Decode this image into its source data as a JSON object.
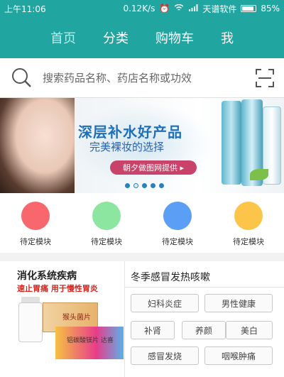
{
  "status_bar": {
    "time": "上午11:06",
    "speed": "0.12K/s",
    "carrier": "天谱软件",
    "battery": "85%",
    "battery_level": 0.85
  },
  "nav": {
    "items": [
      "首页",
      "分类",
      "购物车",
      "我"
    ],
    "active_index": 0
  },
  "search": {
    "placeholder": "搜索药品名称、药店名称或功效"
  },
  "banner": {
    "title": "深层补水好产品",
    "subtitle": "完美裸妆的选择",
    "pill": "朝夕做图网提供 ▸",
    "dot_count": 5,
    "active_dot": 1
  },
  "modules": [
    {
      "label": "待定模块",
      "color": "#f7676d"
    },
    {
      "label": "待定模块",
      "color": "#8de6a0"
    },
    {
      "label": "待定模块",
      "color": "#5b9ef5"
    },
    {
      "label": "待定模块",
      "color": "#fcc54a"
    }
  ],
  "promo": {
    "title": "消化系统疾病",
    "subtitle": "速止胃痛  用于慢性胃炎",
    "box_label_1": "猴头菌片",
    "box_label_2": "铝碳酸镁片 达喜"
  },
  "tags_panel": {
    "title": "冬季感冒发热咳嗽",
    "tags": [
      "妇科炎症",
      "男性健康",
      "补肾",
      "养颜",
      "美白",
      "感冒发烧",
      "咽喉肿痛"
    ]
  }
}
